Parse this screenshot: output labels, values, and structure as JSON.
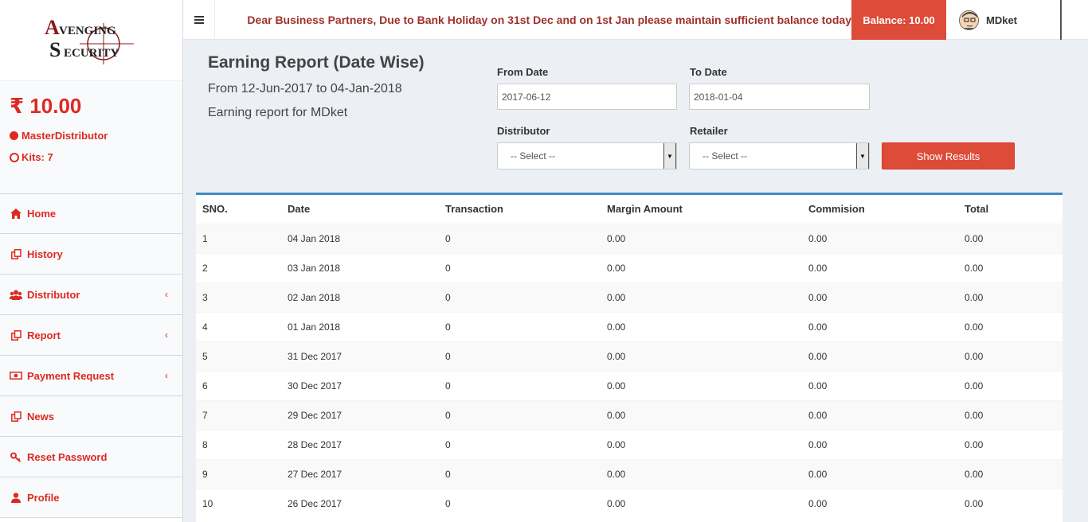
{
  "logo": {
    "line1": "VENGING",
    "initial1": "A",
    "line2": "ECURITY",
    "initial2": "S"
  },
  "sidebar": {
    "balance": "₹ 10.00",
    "role": "MasterDistributor",
    "kits": "Kits: 7",
    "items": [
      {
        "label": "Home",
        "icon": "home-icon",
        "has_chevron": false
      },
      {
        "label": "History",
        "icon": "copy-icon",
        "has_chevron": false
      },
      {
        "label": "Distributor",
        "icon": "users-icon",
        "has_chevron": true
      },
      {
        "label": "Report",
        "icon": "copy-icon",
        "has_chevron": true
      },
      {
        "label": "Payment Request",
        "icon": "money-icon",
        "has_chevron": true
      },
      {
        "label": "News",
        "icon": "copy-icon",
        "has_chevron": false
      },
      {
        "label": "Reset Password",
        "icon": "key-icon",
        "has_chevron": false
      },
      {
        "label": "Profile",
        "icon": "user-icon",
        "has_chevron": false
      }
    ],
    "chevron": "‹"
  },
  "header": {
    "marquee": "Dear Business Partners, Due to Bank Holiday on 31st Dec and on 1st Jan please maintain sufficient balance today",
    "balance_label": "Balance: 10.00",
    "user_name": "MDket"
  },
  "report": {
    "title": "Earning Report (Date Wise)",
    "range": "From 12-Jun-2017 to 04-Jan-2018",
    "for_user": "Earning report for MDket"
  },
  "filters": {
    "from_label": "From Date",
    "from_value": "2017-06-12",
    "to_label": "To Date",
    "to_value": "2018-01-04",
    "distributor_label": "Distributor",
    "distributor_value": "-- Select --",
    "retailer_label": "Retailer",
    "retailer_value": "-- Select --",
    "show_button": "Show Results"
  },
  "table": {
    "headers": [
      "SNO.",
      "Date",
      "Transaction",
      "Margin Amount",
      "Commision",
      "Total"
    ],
    "rows": [
      [
        "1",
        "04 Jan 2018",
        "0",
        "0.00",
        "0.00",
        "0.00"
      ],
      [
        "2",
        "03 Jan 2018",
        "0",
        "0.00",
        "0.00",
        "0.00"
      ],
      [
        "3",
        "02 Jan 2018",
        "0",
        "0.00",
        "0.00",
        "0.00"
      ],
      [
        "4",
        "01 Jan 2018",
        "0",
        "0.00",
        "0.00",
        "0.00"
      ],
      [
        "5",
        "31 Dec 2017",
        "0",
        "0.00",
        "0.00",
        "0.00"
      ],
      [
        "6",
        "30 Dec 2017",
        "0",
        "0.00",
        "0.00",
        "0.00"
      ],
      [
        "7",
        "29 Dec 2017",
        "0",
        "0.00",
        "0.00",
        "0.00"
      ],
      [
        "8",
        "28 Dec 2017",
        "0",
        "0.00",
        "0.00",
        "0.00"
      ],
      [
        "9",
        "27 Dec 2017",
        "0",
        "0.00",
        "0.00",
        "0.00"
      ],
      [
        "10",
        "26 Dec 2017",
        "0",
        "0.00",
        "0.00",
        "0.00"
      ]
    ]
  },
  "colors": {
    "accent": "#dd2a21",
    "button": "#dd4b39",
    "box_border": "#3c8dbc",
    "marquee": "#a0302b"
  }
}
